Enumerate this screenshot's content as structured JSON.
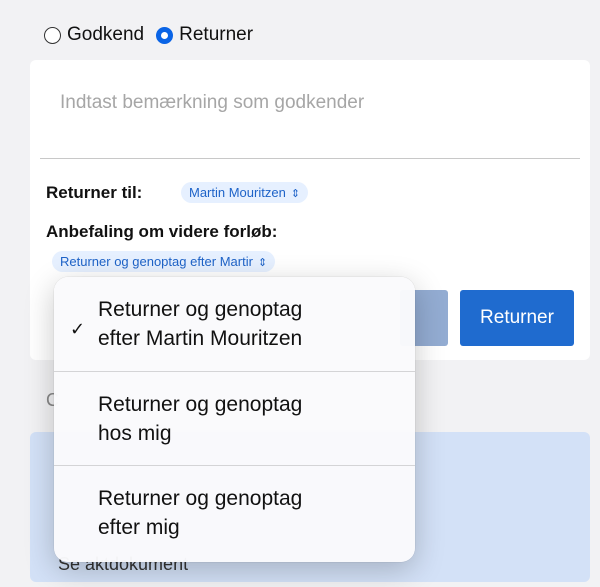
{
  "decision": {
    "approve_label": "Godkend",
    "return_label": "Returner",
    "selected": "return"
  },
  "remark": {
    "placeholder": "Indtast bemærkning som godkender"
  },
  "return_to": {
    "label": "Returner til:",
    "value": "Martin Mouritzen"
  },
  "recommendation": {
    "label": "Anbefaling om videre forløb:",
    "value": "Returner og genoptag efter Martir"
  },
  "actions": {
    "return_button": "Returner"
  },
  "background": {
    "partial_letter": "C",
    "panel_text": "Se aktdokument"
  },
  "menu": {
    "items": [
      {
        "line1": "Returner og genoptag",
        "line2": "efter Martin Mouritzen",
        "checked": true
      },
      {
        "line1": "Returner og genoptag",
        "line2": "hos mig",
        "checked": false
      },
      {
        "line1": "Returner og genoptag",
        "line2": "efter mig",
        "checked": false
      }
    ]
  },
  "icons": {
    "check": "checkmark-icon",
    "chevron": "chevron-updown-icon"
  },
  "colors": {
    "accent": "#0a64e6",
    "button": "#1f6bcf",
    "pill_bg": "#e6f0ff"
  }
}
